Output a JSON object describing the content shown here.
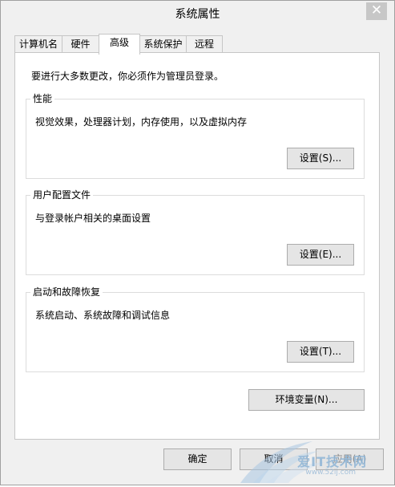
{
  "window": {
    "title": "系统属性",
    "close_glyph": "✕"
  },
  "tabs": [
    {
      "label": "计算机名",
      "active": false
    },
    {
      "label": "硬件",
      "active": false
    },
    {
      "label": "高级",
      "active": true
    },
    {
      "label": "系统保护",
      "active": false
    },
    {
      "label": "远程",
      "active": false
    }
  ],
  "advanced": {
    "notice": "要进行大多数更改，你必须作为管理员登录。",
    "performance": {
      "title": "性能",
      "description": "视觉效果，处理器计划，内存使用，以及虚拟内存",
      "button": "设置(S)..."
    },
    "user_profiles": {
      "title": "用户配置文件",
      "description": "与登录帐户相关的桌面设置",
      "button": "设置(E)..."
    },
    "startup_recovery": {
      "title": "启动和故障恢复",
      "description": "系统启动、系统故障和调试信息",
      "button": "设置(T)..."
    },
    "env_button": "环境变量(N)..."
  },
  "footer": {
    "ok": "确定",
    "cancel": "取消",
    "apply": "应用(A)"
  },
  "watermark": {
    "text": "爱IT技术网",
    "url": "www.52ij.com"
  }
}
